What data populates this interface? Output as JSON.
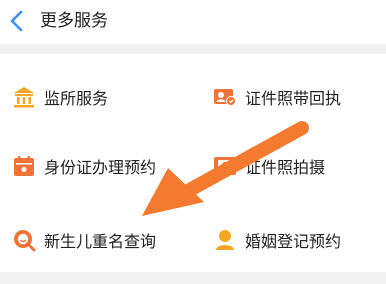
{
  "header": {
    "back_icon": "chevron-left-icon",
    "title": "更多服务"
  },
  "services": [
    {
      "label": "监所服务",
      "icon": "institution-icon"
    },
    {
      "label": "证件照带回执",
      "icon": "photo-receipt-icon"
    },
    {
      "label": "身份证办理预约",
      "icon": "calendar-icon"
    },
    {
      "label": "证件照拍摄",
      "icon": "photo-id-icon"
    },
    {
      "label": "新生儿重名查询",
      "icon": "search-name-icon"
    },
    {
      "label": "婚姻登记预约",
      "icon": "person-icon"
    }
  ],
  "colors": {
    "icon_orange": "#f5a623",
    "icon_red": "#f0733a",
    "arrow": "#f37a2e",
    "back": "#3f8ff0"
  }
}
